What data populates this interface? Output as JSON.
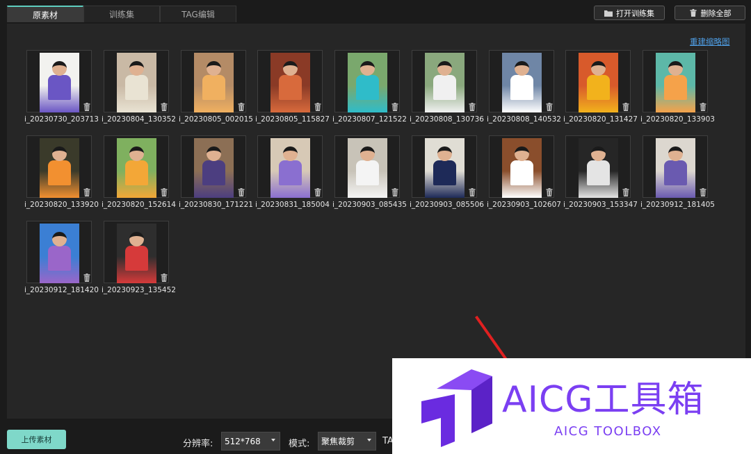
{
  "tabs": [
    {
      "label": "原素材",
      "active": true
    },
    {
      "label": "训练集",
      "active": false
    },
    {
      "label": "TAG编辑",
      "active": false
    }
  ],
  "header_buttons": {
    "open_training": {
      "label": "打开训练集",
      "icon": "folder-icon"
    },
    "delete_all": {
      "label": "删除全部",
      "icon": "trash-icon"
    }
  },
  "rebuild_link": "重建缩略图",
  "thumbnails": [
    {
      "filename": "i_20230730_203713",
      "colors": [
        "#f2f2ef",
        "#6a56c4"
      ]
    },
    {
      "filename": "i_20230804_130352",
      "colors": [
        "#c9b9a5",
        "#e9e3d3"
      ]
    },
    {
      "filename": "i_20230805_002015",
      "colors": [
        "#b48b66",
        "#f0b060"
      ]
    },
    {
      "filename": "i_20230805_115827",
      "colors": [
        "#8a3a26",
        "#d86a3c"
      ]
    },
    {
      "filename": "i_20230807_121522",
      "colors": [
        "#7aa86d",
        "#2fbcc9"
      ]
    },
    {
      "filename": "i_20230808_130736",
      "colors": [
        "#8aa87d",
        "#f0f0f0"
      ]
    },
    {
      "filename": "i_20230808_140532",
      "colors": [
        "#6f86a6",
        "#ffffff"
      ]
    },
    {
      "filename": "i_20230820_131427",
      "colors": [
        "#d85a2b",
        "#f2b21c"
      ]
    },
    {
      "filename": "i_20230820_133903",
      "colors": [
        "#5db8a8",
        "#f5a24a"
      ]
    },
    {
      "filename": "i_20230820_133920",
      "colors": [
        "#3a3a2a",
        "#f29030"
      ]
    },
    {
      "filename": "i_20230820_152614",
      "colors": [
        "#7fb05f",
        "#f3a737"
      ]
    },
    {
      "filename": "i_20230830_171221",
      "colors": [
        "#8c6f55",
        "#4c3e80"
      ]
    },
    {
      "filename": "i_20230831_185004",
      "colors": [
        "#d7c9b6",
        "#8a6fd0"
      ]
    },
    {
      "filename": "i_20230903_085435",
      "colors": [
        "#c8c3b8",
        "#f4f4f4"
      ]
    },
    {
      "filename": "i_20230903_085506",
      "colors": [
        "#e0ddd4",
        "#1e2a58"
      ]
    },
    {
      "filename": "i_20230903_102607",
      "colors": [
        "#8a4e2c",
        "#ffffff"
      ]
    },
    {
      "filename": "i_20230903_153347",
      "colors": [
        "#262626",
        "#e4e4e4"
      ]
    },
    {
      "filename": "i_20230912_181405",
      "colors": [
        "#dcd7cf",
        "#6a5ab0"
      ]
    },
    {
      "filename": "i_20230912_181420",
      "colors": [
        "#3b7fd4",
        "#9a66c9"
      ]
    },
    {
      "filename": "i_20230923_135452",
      "colors": [
        "#2e2e2e",
        "#d63a3a"
      ]
    }
  ],
  "footer": {
    "upload_label": "上传素材",
    "resolution_label": "分辨率:",
    "resolution_value": "512*768",
    "mode_label": "模式:",
    "mode_value": "聚焦裁剪",
    "tag_label": "TA"
  },
  "watermark": {
    "title": "AICG工具箱",
    "subtitle": "AICG TOOLBOX",
    "color": "#7b3ff2"
  },
  "accent": "#5fcfc0"
}
